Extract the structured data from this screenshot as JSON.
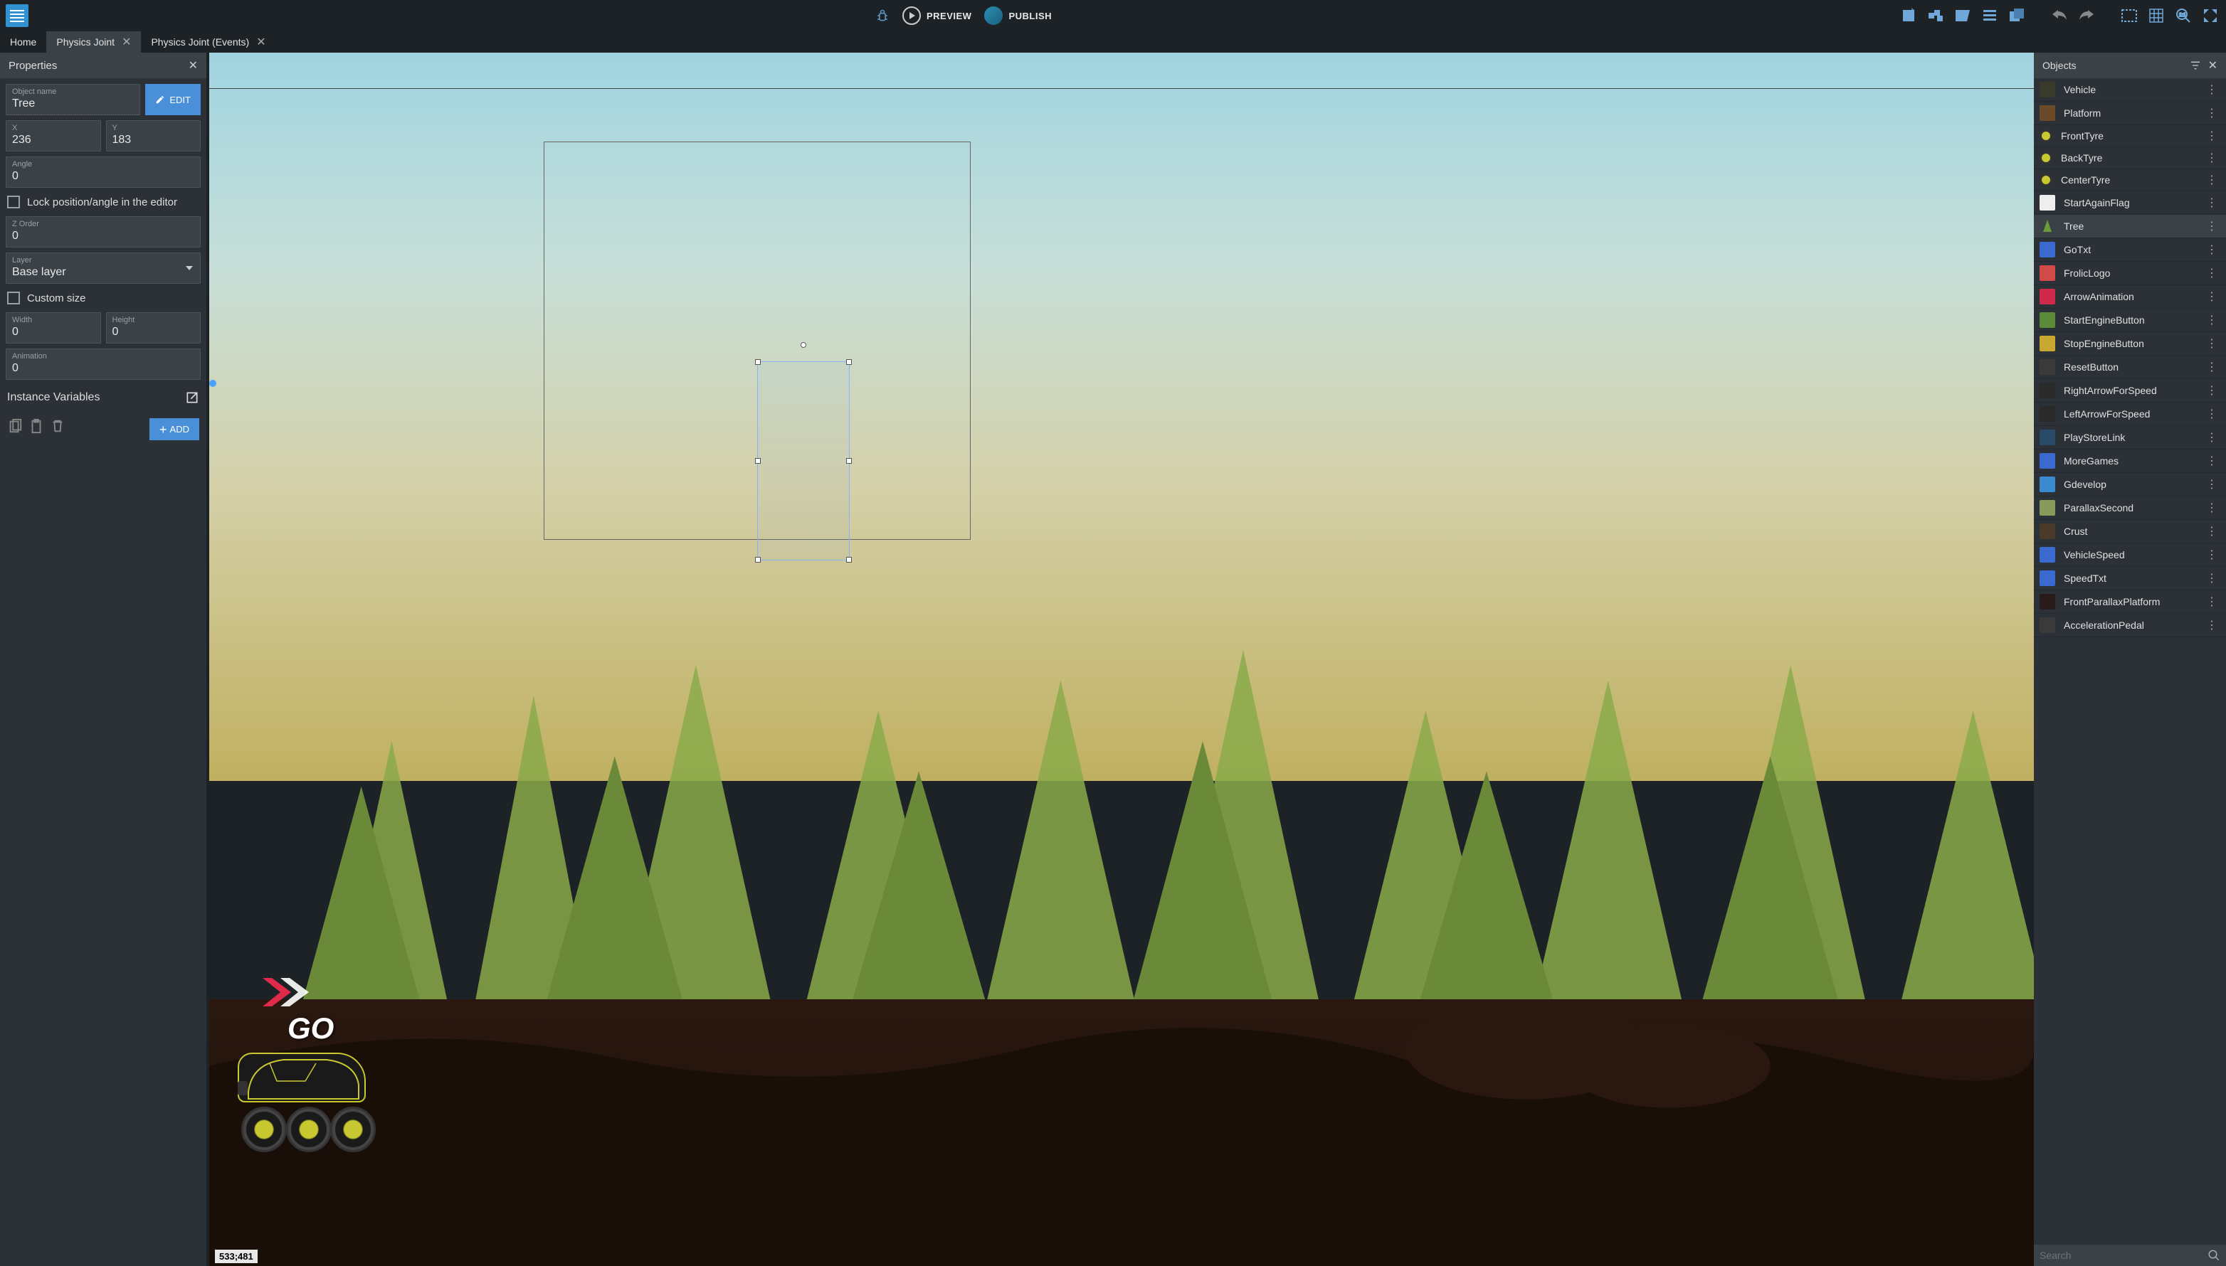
{
  "toolbar": {
    "preview": "PREVIEW",
    "publish": "PUBLISH"
  },
  "tabs": [
    {
      "label": "Home",
      "closable": false,
      "active": false
    },
    {
      "label": "Physics Joint",
      "closable": true,
      "active": true
    },
    {
      "label": "Physics Joint (Events)",
      "closable": true,
      "active": false
    }
  ],
  "properties": {
    "title": "Properties",
    "object_name_label": "Object name",
    "object_name": "Tree",
    "edit_button": "EDIT",
    "x_label": "X",
    "x": "236",
    "y_label": "Y",
    "y": "183",
    "angle_label": "Angle",
    "angle": "0",
    "lock_label": "Lock position/angle in the editor",
    "zorder_label": "Z Order",
    "zorder": "0",
    "layer_label": "Layer",
    "layer": "Base layer",
    "custom_size_label": "Custom size",
    "width_label": "Width",
    "width": "0",
    "height_label": "Height",
    "height": "0",
    "animation_label": "Animation",
    "animation": "0",
    "instance_vars_title": "Instance Variables",
    "add_button": "ADD"
  },
  "scene": {
    "go_text": "GO",
    "coords": "533;481"
  },
  "objects": {
    "title": "Objects",
    "search_placeholder": "Search",
    "items": [
      {
        "name": "Vehicle",
        "thumb_color": "#3a3a2a"
      },
      {
        "name": "Platform",
        "thumb_color": "#6b4a2a"
      },
      {
        "name": "FrontTyre",
        "thumb_color": "#c8c830"
      },
      {
        "name": "BackTyre",
        "thumb_color": "#c8c830"
      },
      {
        "name": "CenterTyre",
        "thumb_color": "#c8c830"
      },
      {
        "name": "StartAgainFlag",
        "thumb_color": "#eeeeee"
      },
      {
        "name": "Tree",
        "thumb_color": "#6a9a3a",
        "selected": true
      },
      {
        "name": "GoTxt",
        "thumb_color": "#3a6ad0"
      },
      {
        "name": "FrolicLogo",
        "thumb_color": "#d04a4a"
      },
      {
        "name": "ArrowAnimation",
        "thumb_color": "#d02a4a"
      },
      {
        "name": "StartEngineButton",
        "thumb_color": "#5a8a3a"
      },
      {
        "name": "StopEngineButton",
        "thumb_color": "#c8a830"
      },
      {
        "name": "ResetButton",
        "thumb_color": "#3a3a3a"
      },
      {
        "name": "RightArrowForSpeed",
        "thumb_color": "#2a2a2a"
      },
      {
        "name": "LeftArrowForSpeed",
        "thumb_color": "#2a2a2a"
      },
      {
        "name": "PlayStoreLink",
        "thumb_color": "#2a4a6a"
      },
      {
        "name": "MoreGames",
        "thumb_color": "#3a6ad0"
      },
      {
        "name": "Gdevelop",
        "thumb_color": "#3a8ad0"
      },
      {
        "name": "ParallaxSecond",
        "thumb_color": "#8a9a5a"
      },
      {
        "name": "Crust",
        "thumb_color": "#4a3a2a"
      },
      {
        "name": "VehicleSpeed",
        "thumb_color": "#3a6ad0"
      },
      {
        "name": "SpeedTxt",
        "thumb_color": "#3a6ad0"
      },
      {
        "name": "FrontParallaxPlatform",
        "thumb_color": "#2a1a1a"
      },
      {
        "name": "AccelerationPedal",
        "thumb_color": "#3a3a3a"
      }
    ]
  }
}
